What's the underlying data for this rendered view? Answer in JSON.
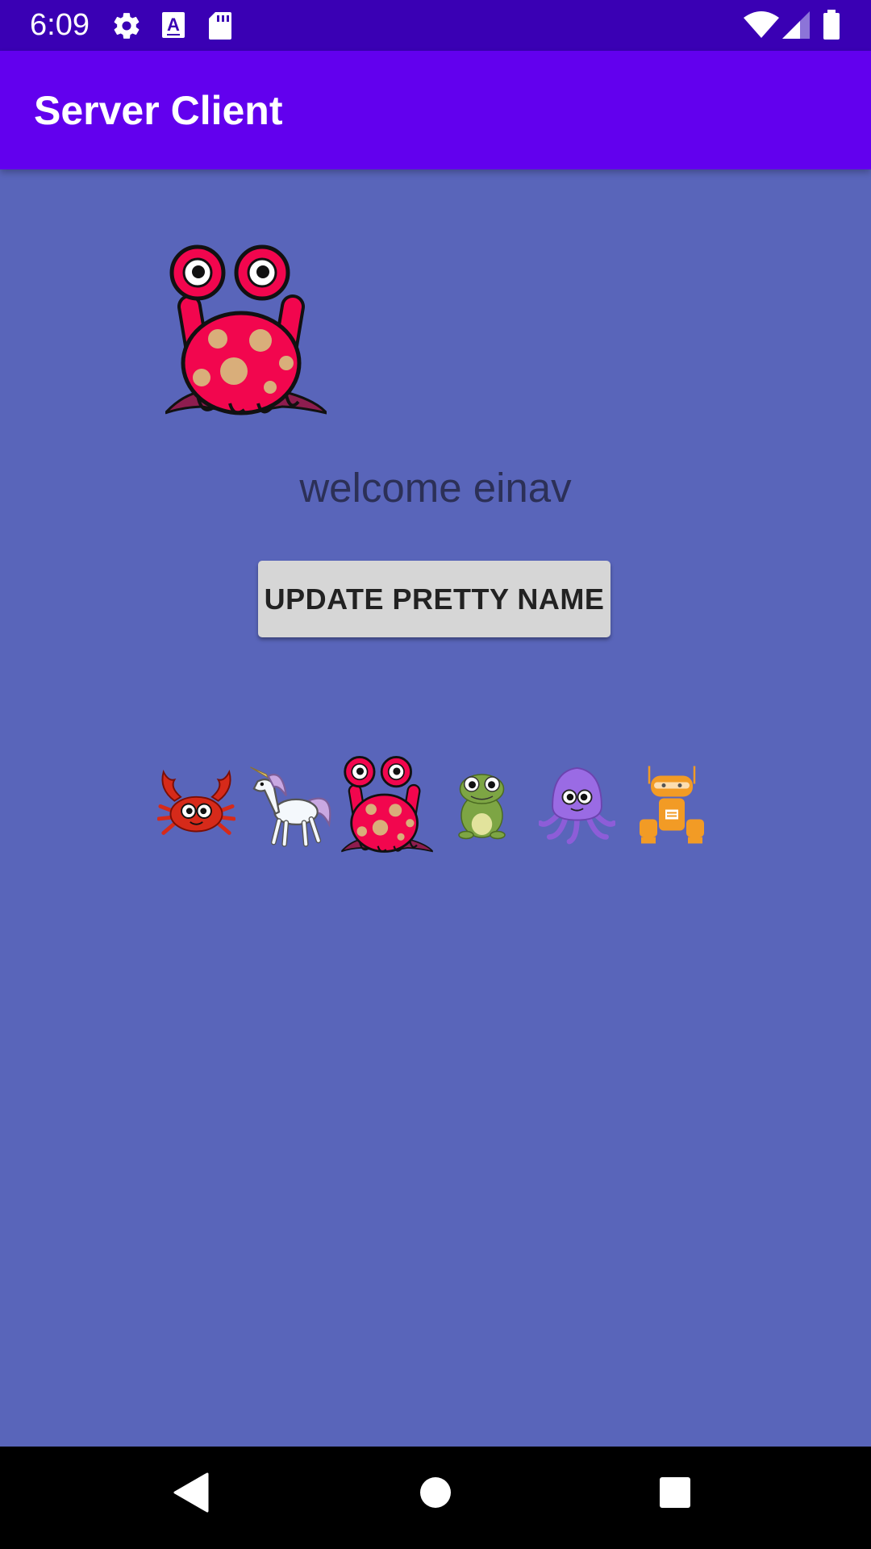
{
  "status_bar": {
    "time": "6:09",
    "icons": [
      "gear-icon",
      "font-a-icon",
      "sd-card-icon",
      "wifi-icon",
      "cell-signal-icon",
      "battery-icon"
    ],
    "color": "#3A00B4"
  },
  "app_bar": {
    "title": "Server Client",
    "color": "#6200EE"
  },
  "main": {
    "background": "#5965BA",
    "current_avatar": "pink-alien-icon",
    "welcome_text": "welcome einav",
    "update_button_label": "UPDATE PRETTY NAME",
    "avatar_options": [
      "crab-icon",
      "unicorn-icon",
      "pink-alien-icon",
      "frog-icon",
      "octopus-icon",
      "robot-icon"
    ]
  },
  "nav_bar": {
    "buttons": [
      "back-icon",
      "home-icon",
      "recents-icon"
    ]
  }
}
